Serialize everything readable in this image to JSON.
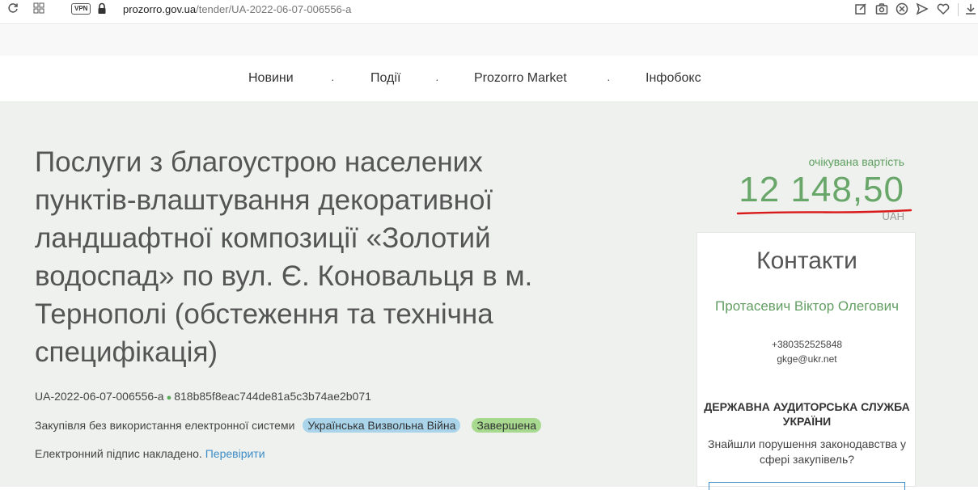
{
  "browser": {
    "url_host": "prozorro.gov.ua",
    "url_path": "/tender/UA-2022-06-07-006556-a",
    "vpn_label": "VPN"
  },
  "nav": {
    "items": [
      "Новини",
      "Події",
      "Prozorro Market",
      "Інфобокс"
    ],
    "separator": "·"
  },
  "tender": {
    "title": "Послуги з благоустрою населених пунктів-влаштування декоративної ландшафтної композиції «Золотий водоспад» по вул. Є. Коновальця в м. Тернополі (обстеження та технічна специфікація)",
    "id": "UA-2022-06-07-006556-a",
    "hash": "818b85f8eac744de81a5c3b74ae2b071",
    "procedure": "Закупівля без використання електронної системи",
    "badges": [
      "Українська Визвольна Війна",
      "Завершена"
    ],
    "signature_text": "Електронний підпис накладено.",
    "signature_link": "Перевірити"
  },
  "expected": {
    "label": "очікувана вартість",
    "value": "12 148,50",
    "currency": "UAH"
  },
  "contacts": {
    "title": "Контакти",
    "name": "Протасевич Віктор Олегович",
    "phone": "+380352525848",
    "email": "gkge@ukr.net"
  },
  "audit": {
    "title": "ДЕРЖАВНА АУДИТОРСЬКА СЛУЖБА УКРАЇНИ",
    "text": "Знайшли порушення законодавства у сфері закупівель?"
  },
  "colors": {
    "main_bg": "#eef1ee",
    "accent_green": "#69a669",
    "link_blue": "#3d8cc7",
    "annotation_red": "#d91a1a"
  }
}
